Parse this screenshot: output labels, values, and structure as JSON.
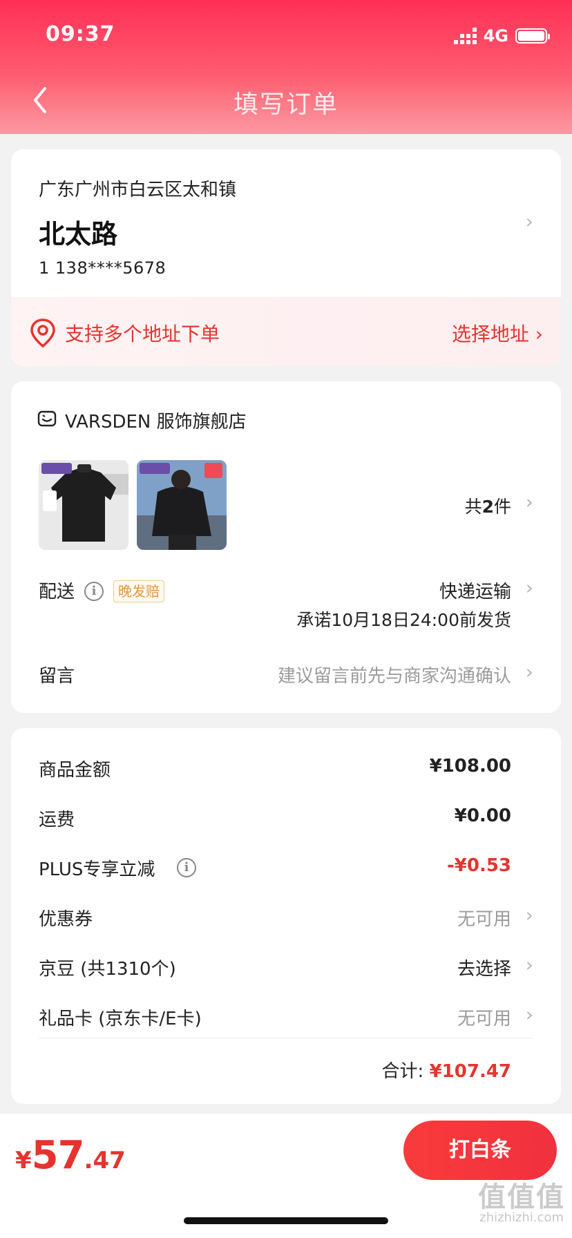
{
  "status_bar": {
    "time": "09:37",
    "network": "4G"
  },
  "nav": {
    "title": "填写订单"
  },
  "address": {
    "region": "广东广州市白云区太和镇",
    "street": "北太路",
    "contact": "1  138****5678",
    "multi_address_text": "支持多个地址下单",
    "select_address_label": "选择地址 ›"
  },
  "order": {
    "shop_name": "VARSDEN 服饰旗舰店",
    "item_count_prefix": "共",
    "item_count": "2",
    "item_count_suffix": "件",
    "delivery_label": "配送",
    "late_tag": "晚发赔",
    "delivery_method": "快递运输",
    "delivery_promise": "承诺10月18日24:00前发货",
    "message_label": "留言",
    "message_placeholder": "建议留言前先与商家沟通确认"
  },
  "price": {
    "rows": [
      {
        "label": "商品金额",
        "value": "¥108.00"
      },
      {
        "label": "运费",
        "value": "¥0.00"
      },
      {
        "label": "PLUS专享立减",
        "value": "-¥0.53"
      },
      {
        "label": "优惠券",
        "value": "无可用"
      },
      {
        "label": "京豆 (共1310个)",
        "value": "去选择"
      },
      {
        "label": "礼品卡 (京东卡/E卡)",
        "value": "无可用"
      }
    ],
    "total_label": "合计: ",
    "total_value": "¥107.47"
  },
  "bottom": {
    "currency": "¥",
    "amount_int": "57",
    "amount_dec": ".47",
    "pay_button": "打白条"
  },
  "watermark": {
    "main": "值值值",
    "sub": "zhizhizhi.com"
  },
  "colors": {
    "accent": "#e5342f",
    "header_start": "#ff2f57",
    "header_end": "#fb9aa2"
  }
}
